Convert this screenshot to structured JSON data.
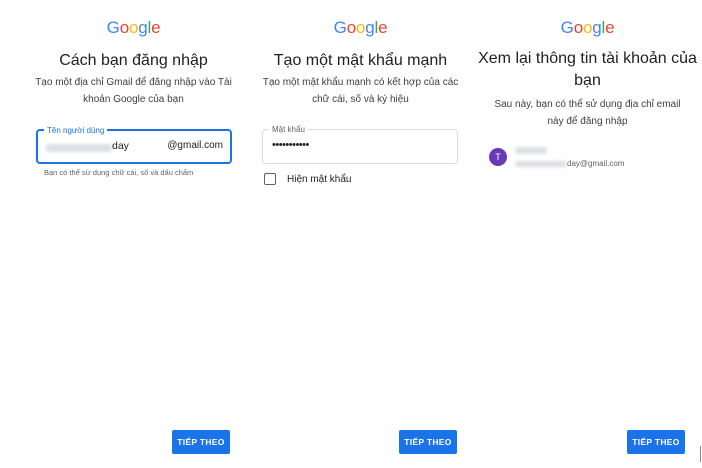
{
  "brand": {
    "logo_letters": [
      {
        "ch": "G",
        "color": "#4285F4"
      },
      {
        "ch": "o",
        "color": "#EA4335"
      },
      {
        "ch": "o",
        "color": "#FBBC05"
      },
      {
        "ch": "g",
        "color": "#4285F4"
      },
      {
        "ch": "l",
        "color": "#34A853"
      },
      {
        "ch": "e",
        "color": "#EA4335"
      }
    ]
  },
  "colors": {
    "accent": "#1a73e8",
    "avatar": "#673ab7"
  },
  "step1": {
    "title": "Cách bạn đăng nhập",
    "description": "Tạo một địa chỉ Gmail để đăng nhập vào Tài khoản Google của bạn",
    "username_label": "Tên người dùng",
    "username_suffix_visible": "day",
    "domain_suffix": "@gmail.com",
    "helper": "Bạn có thể sử dụng chữ cái, số và dấu chấm",
    "next_button": "TIẾP THEO"
  },
  "step2": {
    "title": "Tạo một mật khẩu mạnh",
    "description": "Tạo một mật khẩu mạnh có kết hợp của các chữ cái, số và ký hiệu",
    "password_label": "Mật khẩu",
    "password_value": "•••••••••••",
    "show_password_label": "Hiện mật khẩu",
    "show_password_checked": false,
    "next_button": "TIẾP THEO"
  },
  "step3": {
    "title": "Xem lại thông tin tài khoản của bạn",
    "description": "Sau này, bạn có thể sử dụng địa chỉ email này để đăng nhập",
    "avatar_initial": "T",
    "email_suffix_visible": "day@gmail.com",
    "next_button": "TIẾP THEO"
  }
}
